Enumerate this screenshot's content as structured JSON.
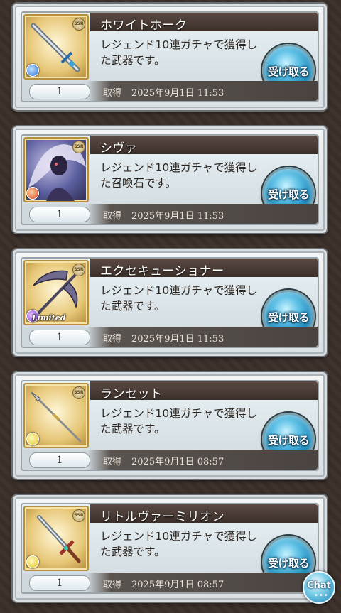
{
  "items": [
    {
      "name": "ホワイトホーク",
      "description": "レジェンド10連ガチャで獲得した武器です。",
      "button_label": "受け取る",
      "quantity": "1",
      "obtained_label": "取得",
      "obtained_date": "2025年9月1日 11:53",
      "type": "weapon",
      "element": "water",
      "rarity": "SSR"
    },
    {
      "name": "シヴァ",
      "description": "レジェンド10連ガチャで獲得した召喚石です。",
      "button_label": "受け取る",
      "quantity": "1",
      "obtained_label": "取得",
      "obtained_date": "2025年9月1日 11:53",
      "type": "summon",
      "element": "fire",
      "rarity": "SSR"
    },
    {
      "name": "エクセキューショナー",
      "description": "レジェンド10連ガチャで獲得した武器です。",
      "button_label": "受け取る",
      "quantity": "1",
      "obtained_label": "取得",
      "obtained_date": "2025年9月1日 11:53",
      "type": "weapon",
      "element": "dark",
      "rarity": "SSR",
      "badge": "Limited"
    },
    {
      "name": "ランセット",
      "description": "レジェンド10連ガチャで獲得した武器です。",
      "button_label": "受け取る",
      "quantity": "1",
      "obtained_label": "取得",
      "obtained_date": "2025年9月1日 08:57",
      "type": "weapon",
      "element": "light",
      "rarity": "SSR"
    },
    {
      "name": "リトルヴァーミリオン",
      "description": "レジェンド10連ガチャで獲得した武器です。",
      "button_label": "受け取る",
      "quantity": "1",
      "obtained_label": "取得",
      "obtained_date": "2025年9月1日 08:57",
      "type": "weapon",
      "element": "light",
      "rarity": "SSR"
    }
  ],
  "chat": {
    "label": "Chat"
  }
}
